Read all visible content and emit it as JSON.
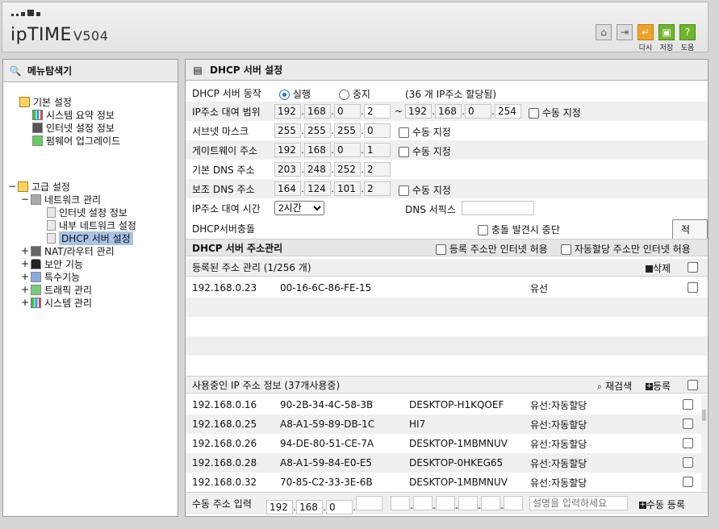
{
  "header": {
    "logo_text": "ipTIME",
    "model": "V504",
    "buttons": [
      {
        "name": "home",
        "label": ""
      },
      {
        "name": "logout",
        "label": ""
      },
      {
        "name": "retry",
        "label": "다시"
      },
      {
        "name": "save",
        "label": "저장"
      },
      {
        "name": "help",
        "label": "도움"
      }
    ]
  },
  "sidebar": {
    "title": "메뉴탐색기",
    "basic": {
      "label": "기본 설정",
      "items": [
        "시스템 요약 정보",
        "인터넷 설정 정보",
        "펌웨어 업그레이드"
      ]
    },
    "advanced": {
      "label": "고급 설정",
      "network": {
        "label": "네트워크 관리",
        "items": [
          "인터넷 설정 정보",
          "내부 네트워크 설정",
          "DHCP 서버 설정"
        ]
      },
      "others": [
        "NAT/라우터 관리",
        "보안 기능",
        "특수기능",
        "트래픽 관리",
        "시스템 관리"
      ]
    }
  },
  "main": {
    "title": "DHCP 서버 설정",
    "server_action": {
      "label": "DHCP 서버 동작",
      "run": "실행",
      "stop": "중지",
      "allocated": "(36 개 IP주소 할당됨)"
    },
    "lease_range": {
      "label": "IP주소 대여 범위",
      "start": [
        "192",
        "168",
        "0",
        "2"
      ],
      "tilde": "~",
      "end": [
        "192",
        "168",
        "0",
        "254"
      ],
      "manual": "수동 지정"
    },
    "subnet": {
      "label": "서브넷 마스크",
      "ip": [
        "255",
        "255",
        "255",
        "0"
      ],
      "manual": "수동 지정"
    },
    "gateway": {
      "label": "게이트웨이 주소",
      "ip": [
        "192",
        "168",
        "0",
        "1"
      ],
      "manual": "수동 지정"
    },
    "dns1": {
      "label": "기본 DNS 주소",
      "ip": [
        "203",
        "248",
        "252",
        "2"
      ]
    },
    "dns2": {
      "label": "보조 DNS 주소",
      "ip": [
        "164",
        "124",
        "101",
        "2"
      ],
      "manual": "수동 지정"
    },
    "lease_time": {
      "label": "IP주소 대여 시간",
      "value": "2시간",
      "dns_suffix_label": "DNS 서픽스",
      "dns_suffix_value": ""
    },
    "conflict": {
      "label": "DHCP서버충돌",
      "stop_label": "충돌 발견시 중단",
      "apply": "적용"
    },
    "addr_mgmt": {
      "title": "DHCP 서버 주소관리",
      "opt1": "등록 주소만 인터넷 허용",
      "opt2": "자동할당 주소만 인터넷 허용"
    },
    "registered": {
      "title": "등록된 주소 관리 (1/256 개)",
      "delete": "삭제",
      "rows": [
        {
          "ip": "192.168.0.23",
          "mac": "00-16-6C-86-FE-15",
          "name": "",
          "type": "유선"
        }
      ]
    },
    "in_use": {
      "title": "사용중인 IP 주소 정보 (37개사용중)",
      "rescan": "재검색",
      "register": "등록",
      "rows": [
        {
          "ip": "192.168.0.16",
          "mac": "90-2B-34-4C-58-3B",
          "name": "DESKTOP-H1KQOEF",
          "type": "유선:자동할당"
        },
        {
          "ip": "192.168.0.25",
          "mac": "A8-A1-59-89-DB-1C",
          "name": "HI7",
          "type": "유선:자동할당"
        },
        {
          "ip": "192.168.0.26",
          "mac": "94-DE-80-51-CE-7A",
          "name": "DESKTOP-1MBMNUV",
          "type": "유선:자동할당"
        },
        {
          "ip": "192.168.0.28",
          "mac": "A8-A1-59-84-E0-E5",
          "name": "DESKTOP-0HKEG65",
          "type": "유선:자동할당"
        },
        {
          "ip": "192.168.0.32",
          "mac": "70-85-C2-33-3E-6B",
          "name": "DESKTOP-1MBMNUV",
          "type": "유선:자동할당"
        }
      ]
    },
    "manual_input": {
      "label": "수동 주소 입력",
      "ip": [
        "192",
        "168",
        "0",
        ""
      ],
      "desc_placeholder": "설명을 입력하세요",
      "register": "수동 등록"
    }
  }
}
